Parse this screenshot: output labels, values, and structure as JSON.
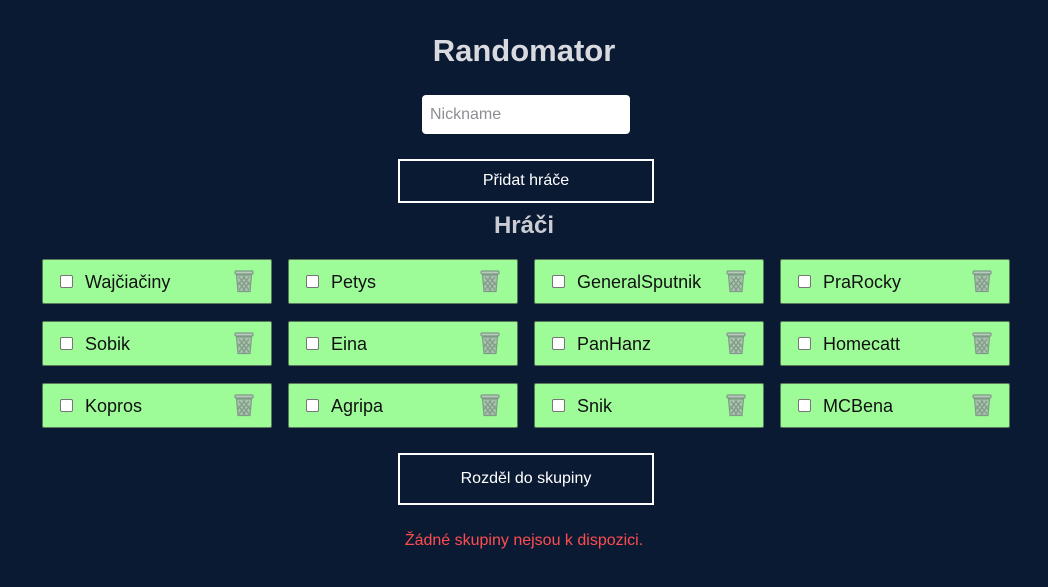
{
  "app": {
    "title": "Randomator"
  },
  "form": {
    "nickname_placeholder": "Nickname",
    "nickname_value": "",
    "add_button_label": "Přidat hráče"
  },
  "players_section": {
    "title": "Hráči",
    "players": [
      {
        "name": "Wajčiačiny",
        "checked": false
      },
      {
        "name": "Petys",
        "checked": false
      },
      {
        "name": "GeneralSputnik",
        "checked": false
      },
      {
        "name": "PraRocky",
        "checked": false
      },
      {
        "name": "Sobik",
        "checked": false
      },
      {
        "name": "Eina",
        "checked": false
      },
      {
        "name": "PanHanz",
        "checked": false
      },
      {
        "name": "Homecatt",
        "checked": false
      },
      {
        "name": "Kopros",
        "checked": false
      },
      {
        "name": "Agripa",
        "checked": false
      },
      {
        "name": "Snik",
        "checked": false
      },
      {
        "name": "MCBena",
        "checked": false
      }
    ],
    "delete_icon": "trash-icon"
  },
  "actions": {
    "split_button_label": "Rozděl do skupiny"
  },
  "status": {
    "message": "Žádné skupiny nejsou k dispozici."
  },
  "colors": {
    "background": "#0b1a33",
    "player_card": "#9dfc98",
    "error_text": "#ff4d4f"
  }
}
